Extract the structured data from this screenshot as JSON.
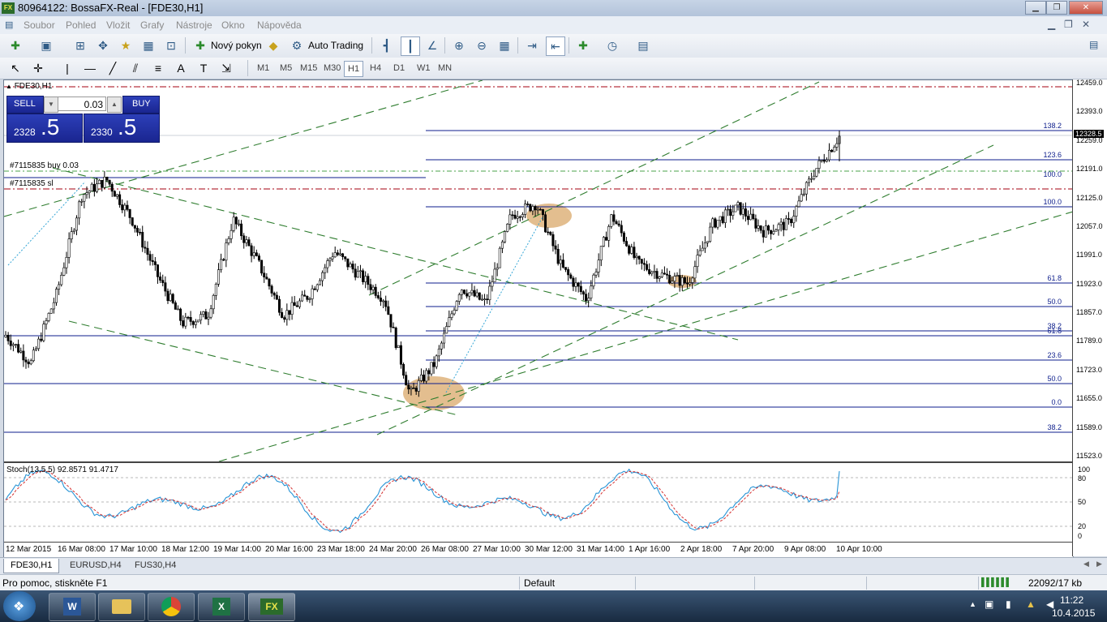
{
  "window": {
    "title": "80964122: BossaFX-Real - [FDE30,H1]",
    "logo": "FX"
  },
  "menu": [
    "Soubor",
    "Pohled",
    "Vložit",
    "Grafy",
    "Nástroje",
    "Okno",
    "Nápověda"
  ],
  "toolbar": {
    "new_order": "Nový pokyn",
    "auto_trading": "Auto Trading"
  },
  "timeframes": [
    "M1",
    "M5",
    "M15",
    "M30",
    "H1",
    "H4",
    "D1",
    "W1",
    "MN"
  ],
  "active_timeframe": "H1",
  "chart": {
    "symbol_label": "FDE30,H1",
    "trade": {
      "sell": "SELL",
      "buy": "BUY",
      "lot": "0.03",
      "sell_price_main": "2328",
      "sell_price_big": ".5",
      "buy_price_main": "2330",
      "buy_price_big": ".5"
    },
    "order_labels": [
      "#7115835 buy 0.03",
      "#7115835 sl"
    ],
    "fib_labels": [
      {
        "text": "138.2"
      },
      {
        "text": "123.6"
      },
      {
        "text": "100.0"
      },
      {
        "text": "100.0"
      },
      {
        "text": "61.8"
      },
      {
        "text": "50.0"
      },
      {
        "text": "38.2"
      },
      {
        "text": "61.8"
      },
      {
        "text": "23.6"
      },
      {
        "text": "50.0"
      },
      {
        "text": "0.0"
      },
      {
        "text": "38.2"
      }
    ],
    "price_ticks": [
      "12459.0",
      "12393.0",
      "12259.0",
      "12191.0",
      "12125.0",
      "12057.0",
      "11991.0",
      "11923.0",
      "11857.0",
      "11789.0",
      "11723.0",
      "11655.0",
      "11589.0",
      "11523.0"
    ],
    "current_price": "12328.5",
    "indicator_label": "Stoch(13,5,5) 92.8571 91.4717",
    "indicator_ticks": [
      "100",
      "80",
      "50",
      "20",
      "0"
    ],
    "time_labels": [
      "12 Mar 2015",
      "16 Mar 08:00",
      "17 Mar 10:00",
      "18 Mar 12:00",
      "19 Mar 14:00",
      "20 Mar 16:00",
      "23 Mar 18:00",
      "24 Mar 20:00",
      "26 Mar 08:00",
      "27 Mar 10:00",
      "30 Mar 12:00",
      "31 Mar 14:00",
      "1 Apr 16:00",
      "2 Apr 18:00",
      "7 Apr 20:00",
      "9 Apr 08:00",
      "10 Apr 10:00"
    ]
  },
  "chart_data": {
    "type": "line",
    "series": [
      {
        "values": [
          11830,
          11760,
          11930,
          12180,
          12220,
          12120,
          11980,
          11860,
          11880,
          12120,
          12010,
          11880,
          11930,
          12040,
          11980,
          11920,
          11680,
          11760,
          11950,
          11910,
          12130,
          12160,
          12000,
          11920,
          12130,
          12010,
          11980,
          11960,
          12110,
          12150,
          12090,
          12110,
          12240,
          12328.5
        ]
      }
    ],
    "ylim": [
      11523,
      12459
    ]
  },
  "tabs": [
    "FDE30,H1",
    "EURUSD,H4",
    "FUS30,H4"
  ],
  "active_tab": "FDE30,H1",
  "status": {
    "help": "Pro pomoc, stiskněte F1",
    "profile": "Default",
    "traffic": "22092/17 kb"
  },
  "tray": {
    "time": "11:22",
    "date": "10.4.2015"
  }
}
